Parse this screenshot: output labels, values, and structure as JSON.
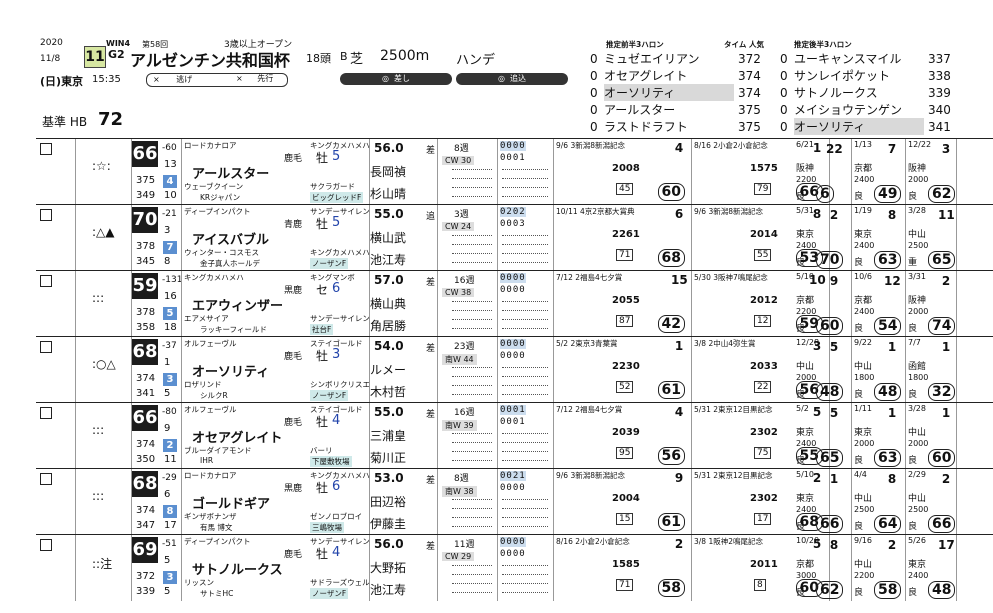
{
  "header": {
    "year": "2020",
    "date": "11/8",
    "weekday": "(日)",
    "venue": "東京",
    "time": "15:35",
    "win": "WIN4",
    "edition": "第58回",
    "race_no": "11",
    "grade": "G2",
    "race_name": "アルゼンチン共和国杯",
    "condition": "3歳以上オープン",
    "runners": "18頭",
    "course_letter": "B",
    "surface": "芝",
    "distance": "2500m",
    "handicap": "ハンデ",
    "base_label": "基準 HB",
    "base_value": "72",
    "style_legend": [
      {
        "mark": "×",
        "label": "逃げ"
      },
      {
        "mark": "×",
        "label": "先行"
      },
      {
        "mark": "◎",
        "label": "差し"
      },
      {
        "mark": "◎",
        "label": "追込"
      }
    ]
  },
  "rankings": {
    "front_title": "推定前半3ハロン",
    "time_title": "タイム 人気",
    "back_title": "推定後半3ハロン",
    "front": [
      {
        "rank": "0",
        "name": "ミュゼエイリアン",
        "time": "372",
        "hl": false
      },
      {
        "rank": "0",
        "name": "オセアグレイト",
        "time": "374",
        "hl": false
      },
      {
        "rank": "0",
        "name": "オーソリティ",
        "time": "374",
        "hl": true
      },
      {
        "rank": "0",
        "name": "アールスター",
        "time": "375",
        "hl": false
      },
      {
        "rank": "0",
        "name": "ラストドラフト",
        "time": "375",
        "hl": false
      }
    ],
    "back": [
      {
        "rank": "0",
        "name": "ユーキャンスマイル",
        "time": "337",
        "hl": false
      },
      {
        "rank": "0",
        "name": "サンレイポケット",
        "time": "338",
        "hl": false
      },
      {
        "rank": "0",
        "name": "サトノルークス",
        "time": "339",
        "hl": false
      },
      {
        "rank": "0",
        "name": "メイショウテンゲン",
        "time": "340",
        "hl": false
      },
      {
        "rank": "0",
        "name": "オーソリティ",
        "time": "341",
        "hl": true
      }
    ]
  },
  "horses": [
    {
      "marks": ":☆:",
      "idx": "66",
      "d1": "-60",
      "d2": "13",
      "n1": "375",
      "n2": "349",
      "w": "4",
      "w2": "10",
      "sire": "ロードカナロア",
      "sire2": "キングカメハメハ",
      "color": "鹿毛",
      "sex": "牡",
      "age": "5",
      "name": "アールスター",
      "mother": "ウェーブクイーン",
      "msire": "サクラガード",
      "owner": "KRジャパン",
      "breeder": "ビッグレッドF",
      "weight": "56.0",
      "jockey": "長岡禎",
      "jockey_alt": "杉山晴",
      "style": "差",
      "interval": "8週",
      "cw": "CW 30",
      "zeros1": "0000",
      "zeros2": "0001",
      "r1": "9/6 3新潟8新潟記念",
      "r1p": "4",
      "r1t": "2008",
      "r1b": "45",
      "r1s": "60",
      "r2": "8/16 2小倉2小倉記念",
      "r2p": "1",
      "r2t": "1575",
      "r2b": "79",
      "r2s": "66",
      "r3": [
        "6/21",
        "22",
        "阪神",
        "2200",
        "良",
        "6"
      ],
      "r3v": "70",
      "r4": [
        "1/13",
        "7",
        "京都",
        "2400",
        "良",
        "49"
      ],
      "r5": [
        "12/22",
        "3",
        "阪神",
        "2000",
        "良",
        "62"
      ]
    },
    {
      "marks": ":△▲",
      "idx": "70",
      "d1": "-21",
      "d2": "3",
      "n1": "378",
      "n2": "345",
      "w": "7",
      "w2": "8",
      "sire": "ディープインパクト",
      "sire2": "サンデーサイレンス",
      "color": "青鹿",
      "sex": "牡",
      "age": "5",
      "name": "アイスバブル",
      "mother": "ウィンター・コスモス",
      "msire": "キングカメハメハ",
      "owner": "金子真人ホールデ",
      "breeder": "ノーザンF",
      "weight": "55.0",
      "jockey": "横山武",
      "jockey_alt": "池江寿",
      "style": "追",
      "interval": "3週",
      "cw": "CW 24",
      "zeros1": "0202",
      "zeros2": "0003",
      "r1": "10/11 4京2京都大賞典",
      "r1p": "6",
      "r1t": "2261",
      "r1b": "71",
      "r1s": "68",
      "r2": "9/6 3新潟8新潟記念",
      "r2p": "8",
      "r2t": "2014",
      "r2b": "55",
      "r2s": "53",
      "r3": [
        "5/31",
        "2",
        "東京",
        "2400",
        "良",
        "70"
      ],
      "r3v": "70",
      "r4": [
        "1/19",
        "8",
        "東京",
        "2400",
        "良",
        "63"
      ],
      "r5": [
        "3/28",
        "11",
        "中山",
        "2500",
        "重",
        "65"
      ]
    },
    {
      "marks": ":::",
      "idx": "59",
      "d1": "-131",
      "d2": "16",
      "n1": "378",
      "n2": "358",
      "w": "5",
      "w2": "18",
      "sire": "キングカメハメハ",
      "sire2": "キングマンボ",
      "color": "黒鹿",
      "sex": "セ",
      "age": "6",
      "name": "エアウィンザー",
      "mother": "エアメサイア",
      "msire": "サンデーサイレンス",
      "owner": "ラッキーフィールド",
      "breeder": "社台F",
      "weight": "57.0",
      "jockey": "横山典",
      "jockey_alt": "角居勝",
      "style": "差",
      "interval": "16週",
      "cw": "CW 38",
      "zeros1": "0000",
      "zeros2": "0000",
      "r1": "7/12 2福島4七夕賞",
      "r1p": "15",
      "r1t": "2055",
      "r1b": "87",
      "r1s": "42",
      "r2": "5/30 3阪神7鳴尾記念",
      "r2p": "10",
      "r2t": "2012",
      "r2b": "12",
      "r2s": "59",
      "r3": [
        "5/10",
        "9",
        "京都",
        "2200",
        "良",
        "60"
      ],
      "r3v": "60",
      "r4": [
        "10/6",
        "12",
        "京都",
        "2400",
        "良",
        "54"
      ],
      "r5": [
        "3/31",
        "2",
        "阪神",
        "2000",
        "良",
        "74"
      ]
    },
    {
      "marks": ":○△",
      "idx": "68",
      "d1": "-37",
      "d2": "1",
      "n1": "374",
      "n2": "341",
      "w": "3",
      "w2": "5",
      "sire": "オルフェーヴル",
      "sire2": "ステイゴールド",
      "color": "鹿毛",
      "sex": "牡",
      "age": "3",
      "name": "オーソリティ",
      "mother": "ロザリンド",
      "msire": "シンボリクリスエス",
      "owner": "シルクR",
      "breeder": "ノーザンF",
      "weight": "54.0",
      "jockey": "ルメー",
      "jockey_alt": "木村哲",
      "style": "差",
      "interval": "23週",
      "cw": "南W 44",
      "zeros1": "0000",
      "zeros2": "0000",
      "r1": "5/2 2東京3青葉賞",
      "r1p": "1",
      "r1t": "2230",
      "r1b": "52",
      "r1s": "61",
      "r2": "3/8 2中山4弥生賞",
      "r2p": "3",
      "r2t": "2033",
      "r2b": "22",
      "r2s": "56",
      "r3": [
        "12/28",
        "5",
        "中山",
        "2000",
        "良",
        "48"
      ],
      "r3v": "48",
      "r4": [
        "9/22",
        "1",
        "中山",
        "1800",
        "良",
        "48"
      ],
      "r5": [
        "7/7",
        "1",
        "函館",
        "1800",
        "良",
        "32"
      ]
    },
    {
      "marks": ":::",
      "idx": "66",
      "d1": "-80",
      "d2": "9",
      "n1": "374",
      "n2": "350",
      "w": "2",
      "w2": "11",
      "sire": "オルフェーヴル",
      "sire2": "ステイゴールド",
      "color": "鹿毛",
      "sex": "牡",
      "age": "4",
      "name": "オセアグレイト",
      "mother": "ブルーダイアモンド",
      "msire": "バーリ",
      "owner": "IHR",
      "breeder": "下屋敷牧場",
      "weight": "55.0",
      "jockey": "三浦皇",
      "jockey_alt": "菊川正",
      "style": "差",
      "interval": "16週",
      "cw": "南W 39",
      "zeros1": "0001",
      "zeros2": "0001",
      "r1": "7/12 2福島4七夕賞",
      "r1p": "4",
      "r1t": "2039",
      "r1b": "95",
      "r1s": "56",
      "r2": "5/31 2東京12目黒記念",
      "r2p": "5",
      "r2t": "2302",
      "r2b": "75",
      "r2s": "55",
      "r3": [
        "5/2",
        "5",
        "東京",
        "2400",
        "良",
        "65"
      ],
      "r3v": "65",
      "r4": [
        "1/11",
        "1",
        "東京",
        "2000",
        "良",
        "63"
      ],
      "r5": [
        "3/28",
        "1",
        "中山",
        "2000",
        "良",
        "60"
      ]
    },
    {
      "marks": ":::",
      "idx": "68",
      "d1": "-29",
      "d2": "6",
      "n1": "374",
      "n2": "347",
      "w": "8",
      "w2": "17",
      "sire": "ロードカナロア",
      "sire2": "キングカメハメハ",
      "color": "黒鹿",
      "sex": "牡",
      "age": "6",
      "name": "ゴールドギア",
      "mother": "ギンザボナンザ",
      "msire": "ゼンノロブロイ",
      "owner": "有馬 博文",
      "breeder": "三嶋牧場",
      "weight": "53.0",
      "jockey": "田辺裕",
      "jockey_alt": "伊藤圭",
      "style": "差",
      "interval": "8週",
      "cw": "南W 38",
      "zeros1": "0021",
      "zeros2": "0000",
      "r1": "9/6 3新潟8新潟記念",
      "r1p": "9",
      "r1t": "2004",
      "r1b": "15",
      "r1s": "61",
      "r2": "5/31 2東京12目黒記念",
      "r2p": "2",
      "r2t": "2302",
      "r2b": "17",
      "r2s": "68",
      "r3": [
        "5/10",
        "1",
        "東京",
        "2400",
        "良",
        "66"
      ],
      "r3v": "66",
      "r4": [
        "4/4",
        "8",
        "中山",
        "2500",
        "良",
        "64"
      ],
      "r5": [
        "2/29",
        "2",
        "中山",
        "2500",
        "良",
        "66"
      ]
    },
    {
      "marks": "::注",
      "idx": "69",
      "d1": "-51",
      "d2": "5",
      "n1": "372",
      "n2": "339",
      "w": "3",
      "w2": "5",
      "sire": "ディープインパクト",
      "sire2": "サンデーサイレンス",
      "color": "鹿毛",
      "sex": "牡",
      "age": "4",
      "name": "サトノルークス",
      "mother": "リッスン",
      "msire": "サドラーズウェルズ",
      "owner": "サトミHC",
      "breeder": "ノーザンF",
      "weight": "56.0",
      "jockey": "大野拓",
      "jockey_alt": "池江寿",
      "style": "差",
      "interval": "11週",
      "cw": "CW 29",
      "zeros1": "0000",
      "zeros2": "0000",
      "r1": "8/16 2小倉2小倉記念",
      "r1p": "2",
      "r1t": "1585",
      "r1b": "71",
      "r1s": "58",
      "r2": "3/8 1阪神2鳴尾記念",
      "r2p": "5",
      "r2t": "2011",
      "r2b": "8",
      "r2s": "60",
      "r3": [
        "10/20",
        "8",
        "京都",
        "3000",
        "良",
        "62"
      ],
      "r3v": "62",
      "r4": [
        "9/16",
        "2",
        "中山",
        "2200",
        "良",
        "58"
      ],
      "r5": [
        "5/26",
        "17",
        "東京",
        "2400",
        "良",
        "48"
      ]
    }
  ]
}
